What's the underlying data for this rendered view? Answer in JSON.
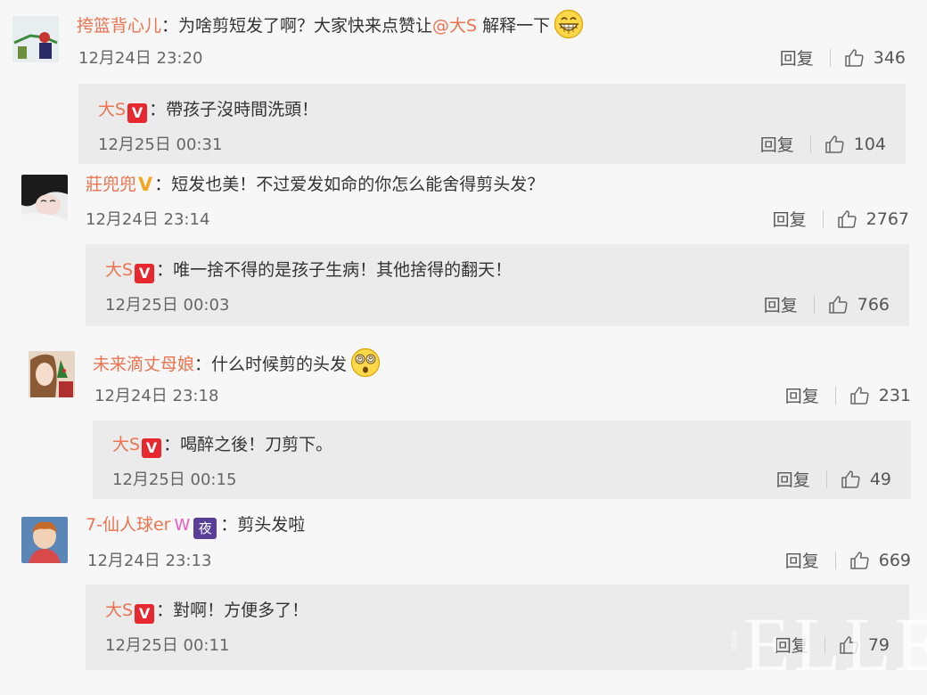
{
  "comments": [
    {
      "username": "挎篮背心儿",
      "text_before": "：为啥剪短发了啊？大家快来点赞让",
      "mention": "@大S",
      "text_after": " 解释一下",
      "emoji": "grin-emoji",
      "time": "12月24日 23:20",
      "reply_label": "回复",
      "likes": "346",
      "reply": {
        "username": "大S",
        "text": "：帶孩子沒時間洗頭！",
        "time": "12月25日 00:31",
        "reply_label": "回复",
        "likes": "104"
      }
    },
    {
      "username": "莊兜兜",
      "text": "：短发也美！不过爱发如命的你怎么能舍得剪头发？",
      "time": "12月24日 23:14",
      "reply_label": "回复",
      "likes": "2767",
      "reply": {
        "username": "大S",
        "text": "：唯一捨不得的是孩子生病！其他捨得的翻天！",
        "time": "12月25日 00:03",
        "reply_label": "回复",
        "likes": "766"
      }
    },
    {
      "username": "未来滴丈母娘",
      "text": "：什么时候剪的头发",
      "emoji": "dizzy-emoji",
      "time": "12月24日 23:18",
      "reply_label": "回复",
      "likes": "231",
      "reply": {
        "username": "大S",
        "text": "：喝醉之後！刀剪下。",
        "time": "12月25日 00:15",
        "reply_label": "回复",
        "likes": "49"
      }
    },
    {
      "username": "7-仙人球er",
      "badge_w": "W",
      "badge_night": "夜",
      "text": "：剪头发啦",
      "time": "12月24日 23:13",
      "reply_label": "回复",
      "likes": "669",
      "reply": {
        "username": "大S",
        "text": "：對啊！方便多了！",
        "time": "12月25日 00:11",
        "reply_label": "回复",
        "likes": "79"
      }
    }
  ],
  "badges": {
    "v_red": "V",
    "v_gold": "V"
  },
  "watermark": {
    "brand": "ELLE",
    "sub": "china"
  },
  "colors": {
    "username": "#eb7350",
    "reply_bg": "#ebebeb",
    "vip_red": "#e8282f",
    "vip_gold": "#f5a623"
  }
}
